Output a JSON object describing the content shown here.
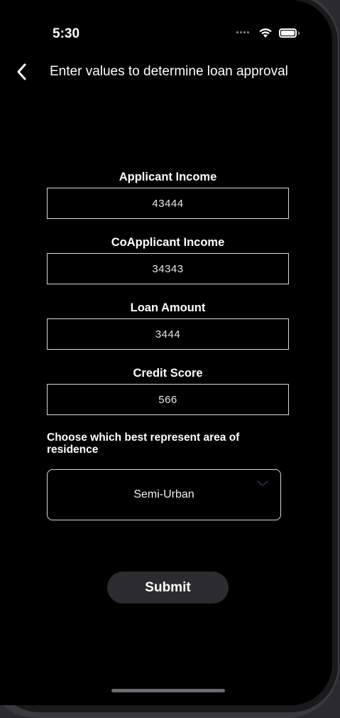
{
  "status_bar": {
    "time": "5:30"
  },
  "nav": {
    "title": "Enter values to determine loan approval",
    "back_icon": "chevron-left-icon"
  },
  "form": {
    "fields": [
      {
        "label": "Applicant Income",
        "value": "43444"
      },
      {
        "label": "CoApplicant Income",
        "value": "34343"
      },
      {
        "label": "Loan Amount",
        "value": "3444"
      },
      {
        "label": "Credit Score",
        "value": "566"
      }
    ],
    "residence_label": "Choose which best represent area of residence",
    "residence_selected": "Semi-Urban",
    "submit_label": "Submit"
  },
  "colors": {
    "background": "#000000",
    "text": "#ffffff",
    "border": "#d9d9d9",
    "button_bg": "#2c2c2e",
    "picker_chevron": "#1c2a4a"
  }
}
